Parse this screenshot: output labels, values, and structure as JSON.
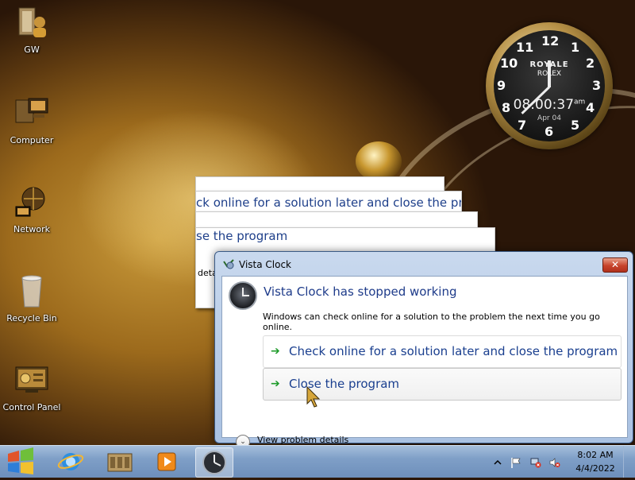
{
  "desktop": {
    "icons": [
      {
        "label": "GW",
        "icon": "folder-user-icon"
      },
      {
        "label": "Computer",
        "icon": "computer-icon"
      },
      {
        "label": "Network",
        "icon": "network-globe-icon"
      },
      {
        "label": "Recycle Bin",
        "icon": "recycle-bin-icon"
      },
      {
        "label": "Control Panel",
        "icon": "control-panel-icon"
      }
    ]
  },
  "gadget_clock": {
    "brand": "ROYALE",
    "brand2": "ROLEX",
    "digital_time": "08:00:37",
    "ampm": "am",
    "date": "Apr 04",
    "numerals": [
      "12",
      "1",
      "2",
      "3",
      "4",
      "5",
      "6",
      "7",
      "8",
      "9",
      "10",
      "11"
    ]
  },
  "ghost_windows": {
    "line1": "ck online for a solution later and close the progra",
    "line2": "se the program",
    "line3": "deta"
  },
  "dialog": {
    "title": "Vista Clock",
    "close_symbol": "✕",
    "headline": "Vista Clock has stopped working",
    "description": "Windows can check online for a solution to the problem the next time you go online.",
    "option1": "Check online for a solution later and close the program",
    "option2": "Close the program",
    "arrow": "➔",
    "details_label": "View problem details",
    "details_chevron": "⌄"
  },
  "taskbar": {
    "time": "8:02 AM",
    "date": "4/4/2022",
    "items": [
      "start-orb-icon",
      "internet-explorer-icon",
      "library-icon",
      "media-player-icon",
      "vista-clock-icon"
    ],
    "tray": [
      "show-hidden-icons-icon",
      "action-center-flag-icon",
      "network-disconnected-icon",
      "volume-muted-icon"
    ]
  },
  "colors": {
    "link_blue": "#1a3f8f",
    "accent_green": "#1f9b2b",
    "close_red": "#c7432b"
  }
}
